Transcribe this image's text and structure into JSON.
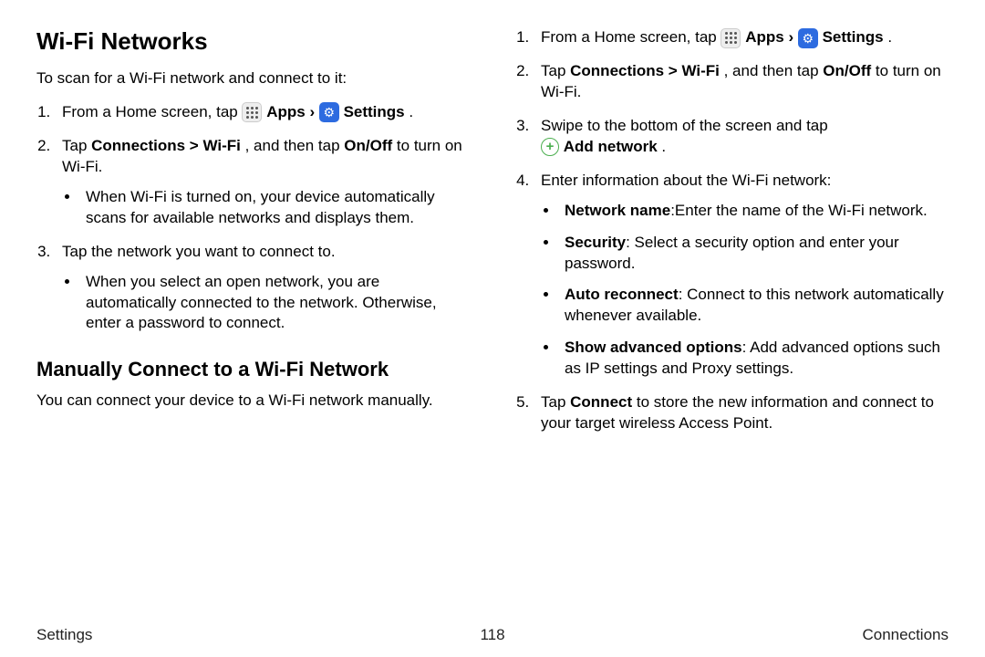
{
  "sectionA": {
    "heading": "Wi-Fi Networks",
    "intro": "To scan for a Wi-Fi network and connect to it:",
    "steps": [
      {
        "prefix": "From a Home screen, tap ",
        "apps_label": " Apps",
        "chevron": " › ",
        "settings_label": " Settings",
        "suffix": ".",
        "has_icons": true
      },
      {
        "line_parts": {
          "a": "Tap ",
          "b": "Connections > Wi-Fi",
          "c": ", and then tap ",
          "d": "On/Off",
          "e": " to turn on Wi-Fi."
        },
        "bullets": [
          "When Wi-Fi is turned on, your device automatically scans for available networks and displays them."
        ]
      },
      {
        "line": "Tap the network you want to connect to.",
        "bullets": [
          "When you select an open network, you are automatically connected to the network. Otherwise, enter a password to connect."
        ]
      }
    ]
  },
  "sectionB": {
    "heading": "Manually Connect to a Wi-Fi Network",
    "intro": "You can connect your device to a Wi-Fi network manually.",
    "steps": [
      {
        "prefix": "From a Home screen, tap ",
        "apps_label": " Apps",
        "chevron": " › ",
        "settings_label": " Settings",
        "suffix": ".",
        "has_icons": true
      },
      {
        "line_parts": {
          "a": "Tap ",
          "b": "Connections > Wi-Fi",
          "c": ", and then tap ",
          "d": "On/Off",
          "e": " to turn on Wi-Fi."
        }
      },
      {
        "line": "Swipe to the bottom of the screen and tap",
        "add_label": " Add network",
        "suffix": "."
      },
      {
        "line": "Enter information about the Wi-Fi network:",
        "bullets": [
          {
            "bold": "Network name",
            "rest": ":Enter the name of the Wi-Fi network."
          },
          {
            "bold": "Security",
            "rest": ": Select a security option and enter your password."
          },
          {
            "bold": "Auto reconnect",
            "rest": ": Connect to this network automatically whenever available."
          },
          {
            "bold": "Show advanced options",
            "rest": ": Add advanced options such as IP settings and Proxy settings."
          }
        ]
      },
      {
        "line_parts": {
          "a": "Tap ",
          "b": "Connect",
          "c": " to store the new information and connect to your target wireless Access Point."
        }
      }
    ]
  },
  "footer": {
    "left": "Settings",
    "center": "118",
    "right": "Connections"
  }
}
